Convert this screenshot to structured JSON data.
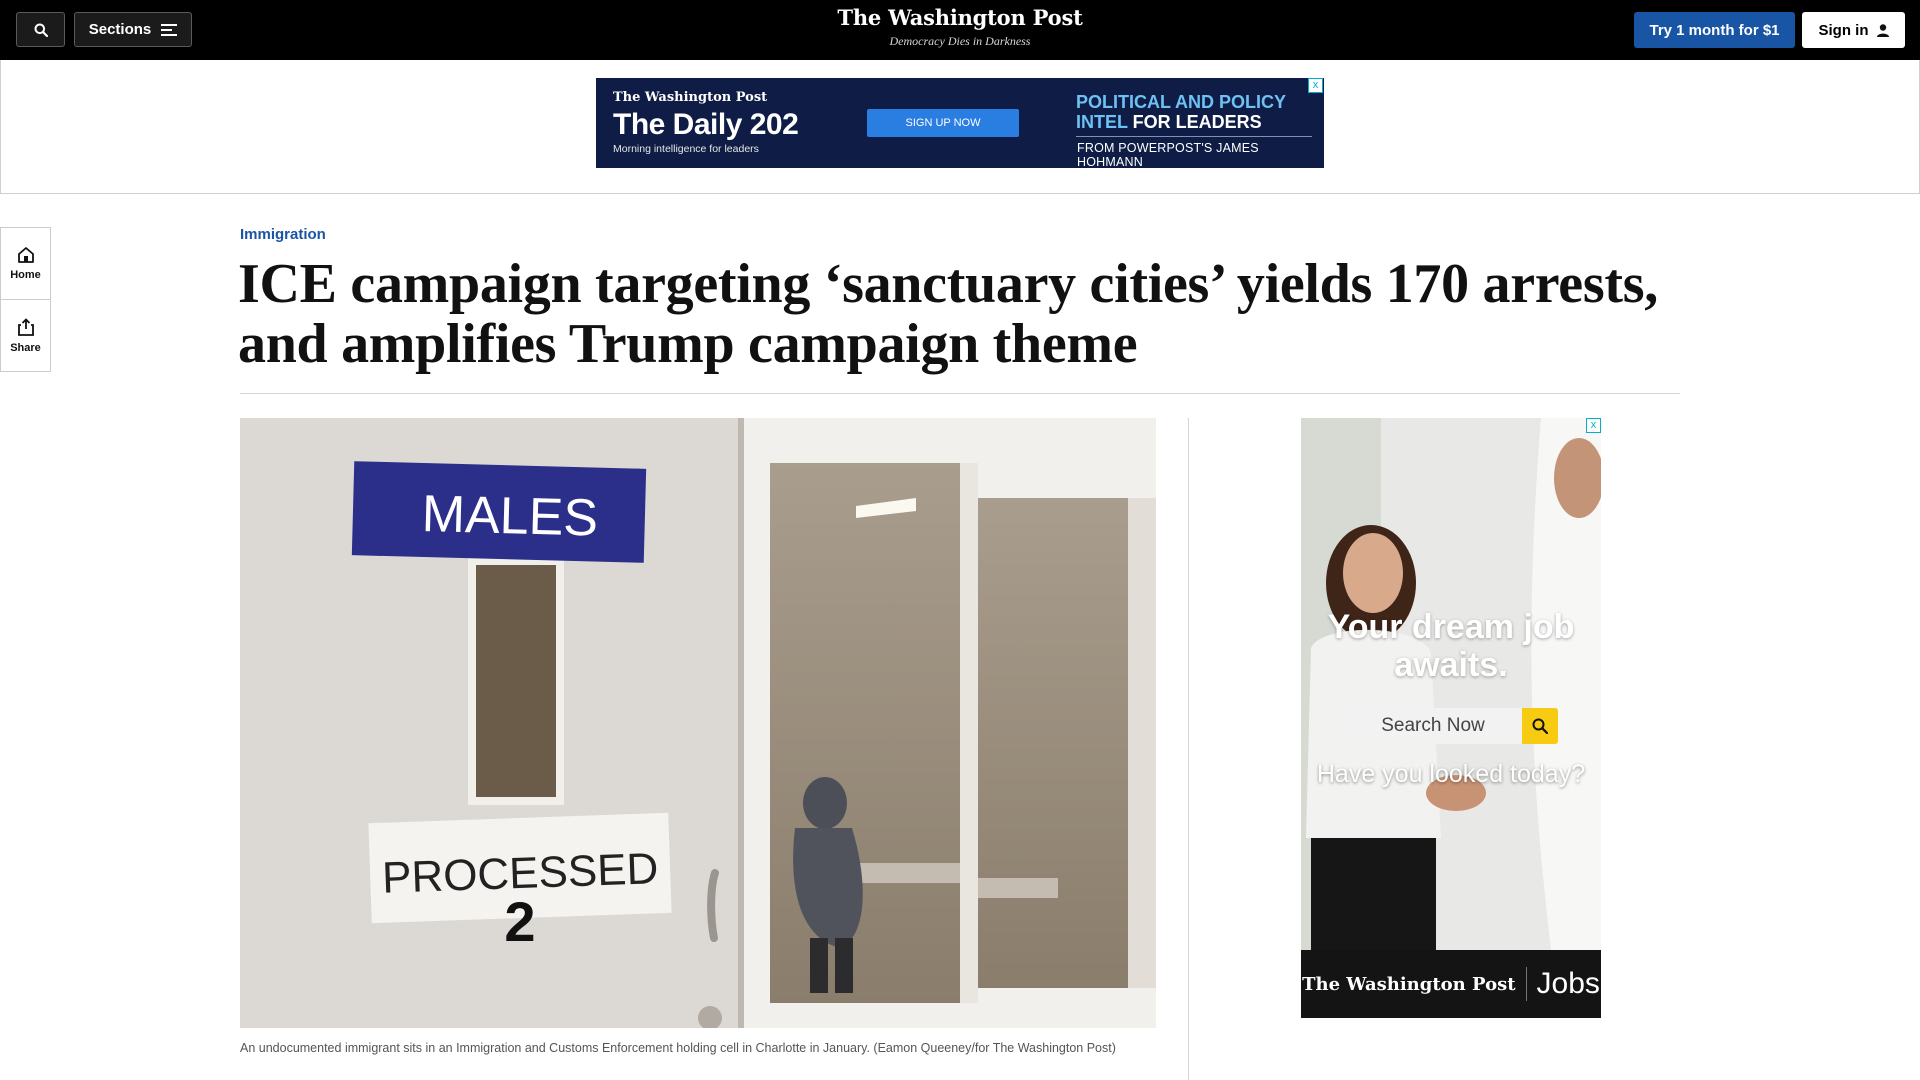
{
  "header": {
    "sections_label": "Sections",
    "logo": "The Washington Post",
    "tagline": "Democracy Dies in Darkness",
    "try_label": "Try 1 month for $1",
    "signin_label": "Sign in"
  },
  "top_ad": {
    "brand": "The Washington Post",
    "title": "The Daily 202",
    "subtitle": "Morning intelligence for leaders",
    "cta": "SIGN UP NOW",
    "headline_blue": "POLITICAL AND POLICY INTEL",
    "headline_white": " FOR LEADERS",
    "byline": "FROM POWERPOST'S JAMES HOHMANN",
    "close": "x"
  },
  "rail": {
    "home_label": "Home",
    "share_label": "Share"
  },
  "article": {
    "kicker": "Immigration",
    "headline": "ICE campaign targeting ‘sanctuary cities’ yields 170 arrests, and amplifies Trump campaign theme",
    "image": {
      "sign_top": "MALES",
      "sign_bottom": "PROCESSED",
      "sign_number": "2"
    },
    "caption": "An undocumented immigrant sits in an Immigration and Customs Enforcement holding cell in Charlotte in January. (Eamon Queeney/for The Washington Post)"
  },
  "side_ad": {
    "headline": "Your dream job awaits.",
    "search_text": "Search Now",
    "question": "Have you looked today?",
    "footer_brand": "The Washington Post",
    "footer_jobs": "Jobs",
    "close": "x"
  }
}
